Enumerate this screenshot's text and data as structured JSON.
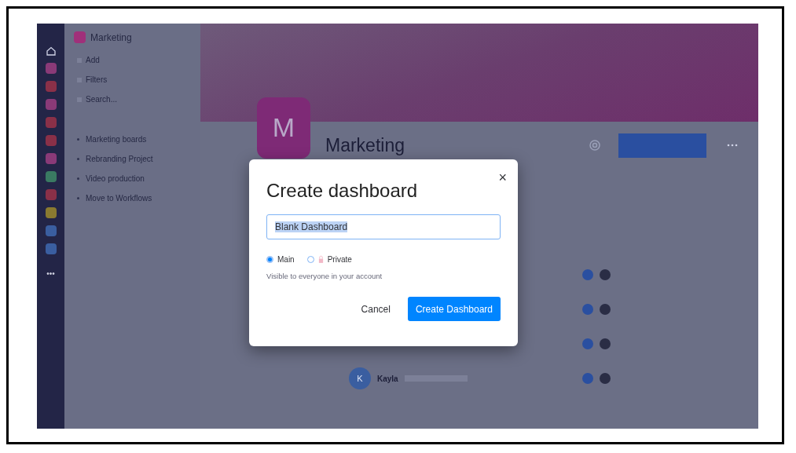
{
  "rail": {
    "items": [
      {
        "color": "#8a3a78"
      },
      {
        "color": "#8a3048"
      },
      {
        "color": "#8a3a78"
      },
      {
        "color": "#8a3048"
      },
      {
        "color": "#8a3048"
      },
      {
        "color": "#8a3a78"
      },
      {
        "color": "#3a7a62"
      },
      {
        "color": "#8a3048"
      },
      {
        "color": "#8a7a30"
      },
      {
        "color": "#3a5ea0"
      },
      {
        "color": "#3a5ea0"
      }
    ],
    "more": "•••"
  },
  "sidebar": {
    "title": "Marketing",
    "actions": [
      "Add",
      "Filters",
      "Search..."
    ],
    "items": [
      "Marketing boards",
      "Rebranding Project",
      "Video production",
      "Move to Workflows"
    ]
  },
  "header": {
    "logo_letter": "M",
    "title": "Marketing"
  },
  "members": [
    {
      "kind": "covered"
    },
    {
      "kind": "covered"
    },
    {
      "kind": "covered"
    },
    {
      "kind": "person",
      "initial": "K",
      "name": "Kayla"
    }
  ],
  "dialog": {
    "title": "Create dashboard",
    "close": "×",
    "input_value": "Blank Dashboard",
    "options": [
      {
        "label": "Main",
        "selected": true
      },
      {
        "label": "Private",
        "selected": false
      }
    ],
    "hint": "Visible to everyone in your account",
    "cancel": "Cancel",
    "confirm": "Create Dashboard"
  }
}
